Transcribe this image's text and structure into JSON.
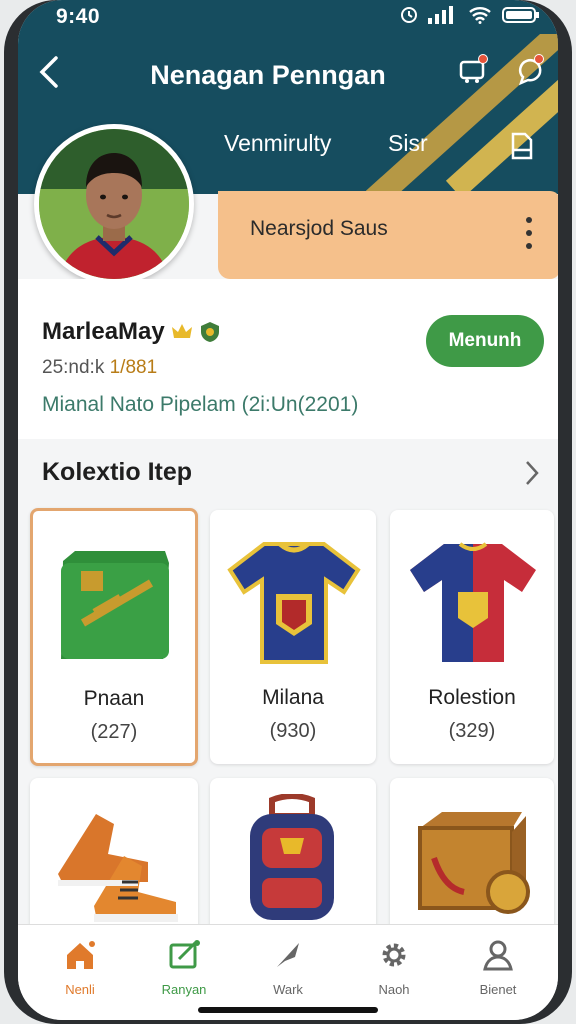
{
  "status_bar": {
    "time": "9:40"
  },
  "header": {
    "title": "Nenagan Penngan",
    "tabs": [
      "Venmirulty",
      "Sisr"
    ]
  },
  "status_card": {
    "label": "Nearsjod Saus"
  },
  "profile": {
    "name": "MarleaMay",
    "stats_prefix": "25:nd:k",
    "stats_highlight": "1/881",
    "meta": "Mianal Nato Pipelam (2i:Un(2201)",
    "follow_label": "Menunh"
  },
  "collection": {
    "title": "Kolextio Itep",
    "items": [
      {
        "name": "Pnaan",
        "count": "(227)"
      },
      {
        "name": "Milana",
        "count": "(930)"
      },
      {
        "name": "Rolestion",
        "count": "(329)"
      },
      {
        "name": "",
        "count": ""
      },
      {
        "name": "",
        "count": ""
      },
      {
        "name": "",
        "count": ""
      }
    ]
  },
  "bottom_nav": [
    {
      "label": "Nenli",
      "icon": "home-icon",
      "color": "#e07a2c"
    },
    {
      "label": "Ranyan",
      "icon": "edit-icon",
      "color": "#3f9a47"
    },
    {
      "label": "Wark",
      "icon": "pen-icon",
      "color": "#666666"
    },
    {
      "label": "Naoh",
      "icon": "gear-icon",
      "color": "#666666"
    },
    {
      "label": "Bienet",
      "icon": "person-icon",
      "color": "#666666"
    }
  ],
  "colors": {
    "header": "#164d5f",
    "accent_orange": "#f5c08b",
    "accent_green": "#3f9a47"
  }
}
